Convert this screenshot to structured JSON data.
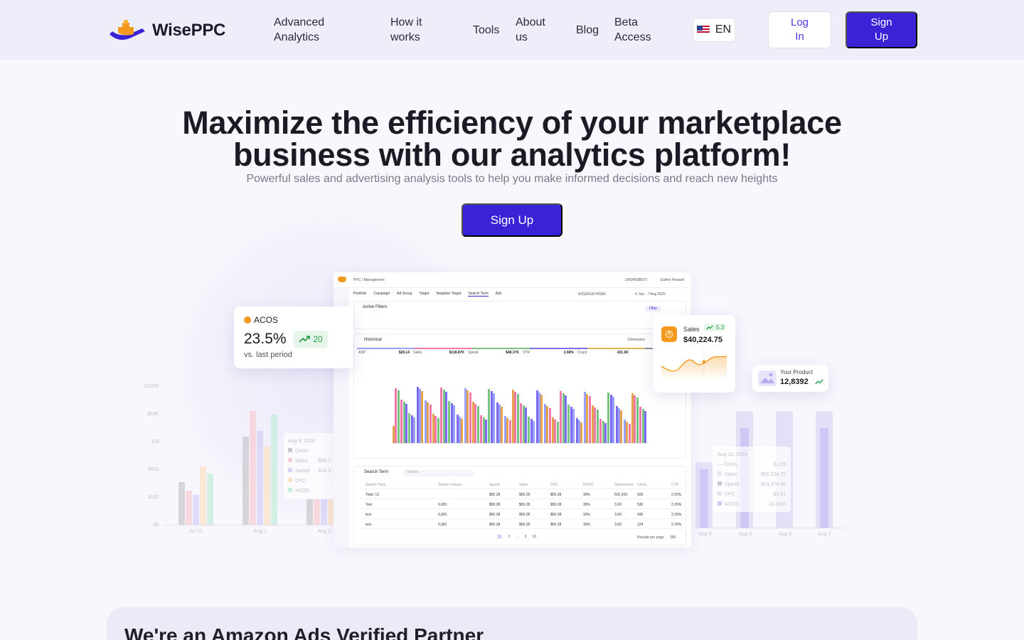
{
  "brand": {
    "name": "WisePPC"
  },
  "nav": {
    "items": [
      "Advanced Analytics",
      "How it works",
      "Tools",
      "About us",
      "Blog",
      "Beta Access"
    ],
    "language": "EN",
    "login_label": "Log In",
    "signup_label": "Sign Up"
  },
  "hero": {
    "title": "Maximize the efficiency of your marketplace business with our analytics platform!",
    "subtitle": "Powerful sales and advertising analysis tools to help you make informed decisions and reach new heights",
    "cta_label": "Sign Up"
  },
  "acos_card": {
    "label": "ACOS",
    "value": "23.5%",
    "change": "20",
    "caption": "vs. last period"
  },
  "sales_card": {
    "label": "Sales",
    "value": "$40,224.75",
    "change": "5.3"
  },
  "product_card": {
    "label": "Your Product",
    "value": "12,8392"
  },
  "left_chart": {
    "y_ticks": [
      "$100K",
      "$50K",
      "$1K",
      "$500",
      "$100",
      "$0"
    ],
    "x_ticks": [
      "Jul 31",
      "Aug 1",
      "Aug 2"
    ],
    "tooltip": {
      "date": "Aug 4, 2024",
      "rows": [
        "Clicks",
        "Sales",
        "Spend",
        "CPC",
        "ACOS"
      ],
      "values": [
        "",
        "$59.2",
        "$24.3",
        "",
        ""
      ]
    }
  },
  "right_chart": {
    "x_ticks": [
      "Aug 3",
      "Aug 5",
      "Aug 6",
      "Aug 7"
    ],
    "tooltip": {
      "date": "Aug 13, 2024",
      "rows": [
        "Clicks",
        "Sales",
        "Spend",
        "CPC",
        "ACOS"
      ],
      "values": [
        "6,225",
        "$59,224.75",
        "$24,374.60",
        "$1.61",
        "41.18%"
      ]
    }
  },
  "dashboard": {
    "breadcrumb": "PPC / Management",
    "account_id": "UR54508837I",
    "user": "Esther Howard",
    "tabs": [
      "Portfolio",
      "Campaign",
      "Ad Group",
      "Target",
      "Negative Target",
      "Search Term",
      "Ads"
    ],
    "date_range": "4 July - 7 Aug 2025",
    "store": "A2Q4SG67HSN0",
    "filters_title": "Active Filters",
    "filter_label": "Filter",
    "historical_label": "Historical",
    "dimension_label": "Dimension",
    "metrics": [
      {
        "name": "ASP",
        "value": "$28.14"
      },
      {
        "name": "Sales",
        "value": "$118.87K"
      },
      {
        "name": "Spend",
        "value": "$48.37K"
      },
      {
        "name": "VTR",
        "value": "2.68%"
      },
      {
        "name": "Count",
        "value": "431.6K"
      }
    ],
    "search_term_title": "Search Term",
    "search_placeholder": "Search",
    "table_headers": [
      "Search Term",
      "Search Volume",
      "Spend",
      "Sales",
      "CPC",
      "ROAS",
      "Impressions",
      "Clicks",
      "CTR"
    ],
    "table_rows": [
      [
        "Total: 13",
        "",
        "$50.28",
        "$50.28",
        "$50.28",
        "30%",
        "502,209",
        "600",
        "2.25%"
      ],
      [
        "Test",
        "6,081",
        "$50.28",
        "$50.28",
        "$50.28",
        "30%",
        "3.09",
        "530",
        "2.25%"
      ],
      [
        "test",
        "6,081",
        "$50.28",
        "$50.28",
        "$50.28",
        "30%",
        "3.09",
        "430",
        "2.25%"
      ],
      [
        "test",
        "6,081",
        "$50.28",
        "$50.28",
        "$50.28",
        "30%",
        "3.09",
        "124",
        "2.25%"
      ]
    ],
    "pages": [
      "1",
      "2",
      "...",
      "9",
      "10"
    ],
    "per_page_label": "Results per page",
    "per_page_value": "300"
  },
  "partner": {
    "title": "We're an Amazon Ads Verified Partner"
  },
  "colors": {
    "accent": "#3a23d6",
    "orange": "#f39a1e",
    "green": "#2a9b4a"
  }
}
